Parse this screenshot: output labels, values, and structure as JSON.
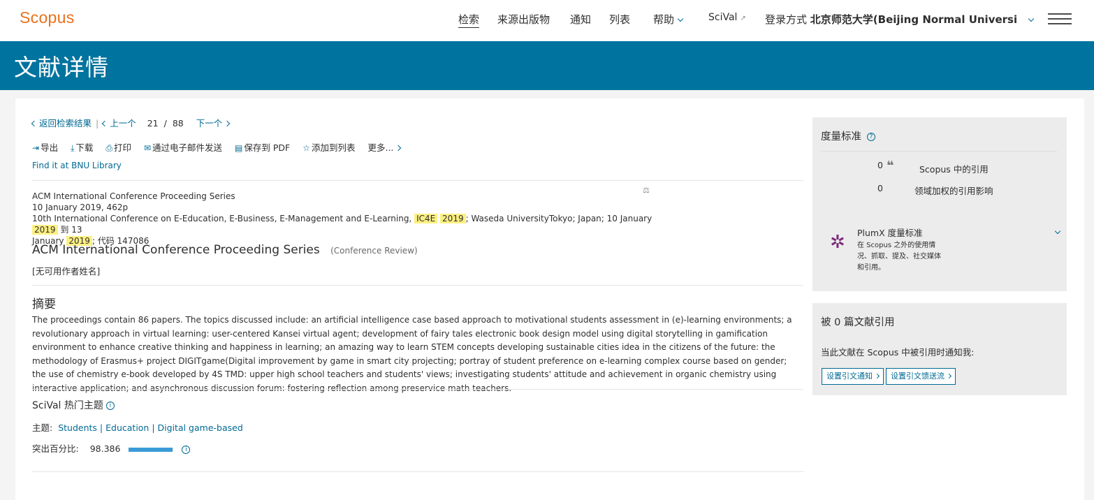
{
  "header": {
    "logo": "Scopus",
    "nav": {
      "search": "检索",
      "sources": "来源出版物",
      "alerts": "通知",
      "lists": "列表",
      "help": "帮助",
      "scival": "SciVal",
      "scival_ext": "↗",
      "login_prefix": "登录方式",
      "login_org": "北京师范大学(Beijing Normal Universi"
    }
  },
  "banner": {
    "title": "文献详情"
  },
  "pager": {
    "back": "返回检索结果",
    "prev": "上一个",
    "current": "21",
    "slash": "/",
    "total": "88",
    "next": "下一个"
  },
  "toolbar": {
    "export": "导出",
    "download": "下载",
    "print": "打印",
    "email": "通过电子邮件发送",
    "save_pdf": "保存到 PDF",
    "add_list": "添加到列表",
    "more": "更多..."
  },
  "findit": "Find it at BNU Library",
  "source": {
    "series": "ACM International Conference Proceeding Series",
    "date_pages": "10 January 2019, 462p",
    "conf_a": "10th International Conference on E-Education, E-Business, E-Management and E-Learning,",
    "hl_1": "IC4E",
    "hl_2": "2019",
    "conf_b": "; Waseda UniversityTokyo; Japan; 10 January",
    "hl_3": "2019",
    "conf_c": "到 13",
    "conf_d": "January",
    "hl_4": "2019",
    "code": "; 代码 147086"
  },
  "document": {
    "title": "ACM International Conference Proceeding Series",
    "type": "(Conference Review)",
    "author": "[无可用作者姓名]"
  },
  "abstract": {
    "heading": "摘要",
    "text": "The proceedings contain 86 papers. The topics discussed include: an artificial intelligence case based approach to motivational students assessment in (e)-learning environments; a revolutionary approach in virtual learning: user-centered Kansei virtual agent; development of fairy tales electronic book design model using digital storytelling in gamification environment to enhance creative thinking and happiness in learning; an amazing way to learn STEM concepts developing sustainable cities idea in the citizens of the future: the methodology of Erasmus+ project DIGITgame(Digital improvement by game in smart city projecting; portray of student preference on e-learning complex course based on gender; the use of chemistry e-book developed by 4S TMD: upper high school teachers and students' views; investigating students' attitude and achievement in organic chemistry using interactive application; and asynchronous discussion forum: fostering reflection among preservice math teachers."
  },
  "scival": {
    "heading": "SciVal 热门主题",
    "topic_label": "主题:",
    "topics": [
      "Students",
      "Education",
      "Digital game-based"
    ],
    "topic_sep": "|",
    "pct_label": "突出百分比:",
    "pct_value": "98.386",
    "pct_fraction": 0.98386,
    "bar_color": "#3a9bd8"
  },
  "metrics": {
    "heading": "度量标准",
    "citations_count": "0",
    "citations_label": "Scopus 中的引用",
    "fwci_value": "0",
    "fwci_label": "领域加权的引用影响",
    "plumx_heading": "PlumX 度量标准",
    "plumx_desc": "在 Scopus 之外的使用情况、抓取、提及、社交媒体和引用。"
  },
  "cited_by": {
    "heading": "被 0 篇文献引用",
    "notify": "当此文献在 Scopus 中被引用时通知我:",
    "alert_btn": "设置引文通知",
    "feed_btn": "设置引文馈送流"
  },
  "colors": {
    "accent": "#00739e",
    "link": "#006a94",
    "brand": "#e9711c",
    "highlight": "#fdf082"
  }
}
